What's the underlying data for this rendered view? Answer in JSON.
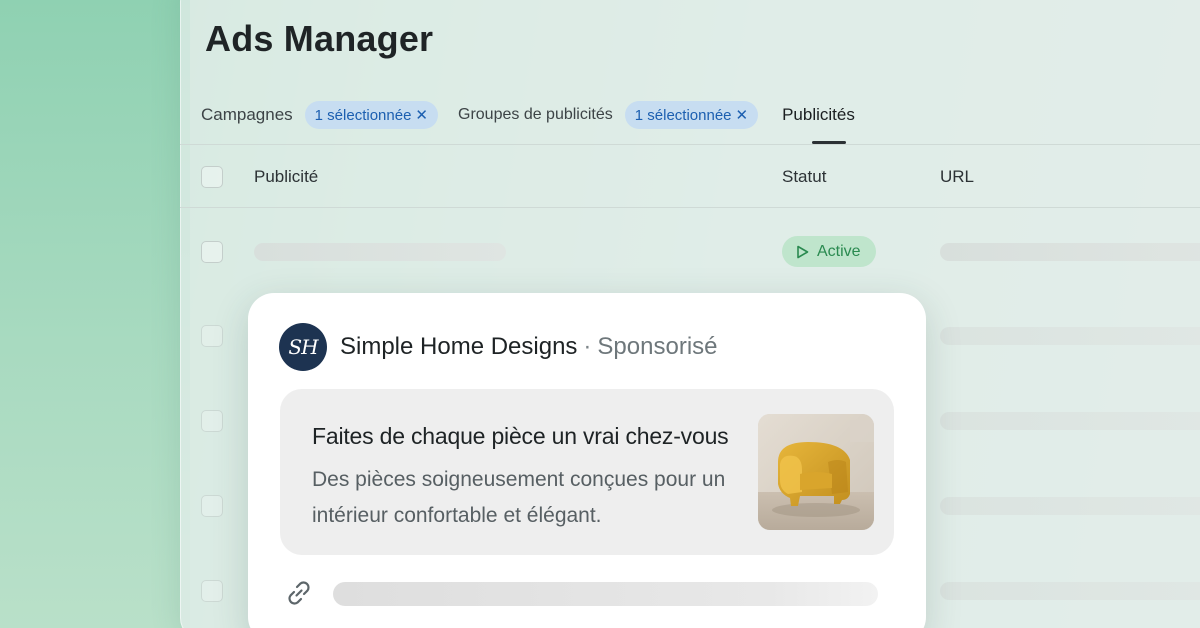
{
  "app": {
    "title": "Ads Manager"
  },
  "tabs": {
    "campaigns_label": "Campagnes",
    "campaigns_chip": "1 sélectionnée",
    "adsets_label": "Groupes de publicités",
    "adsets_chip": "1 sélectionnée",
    "ads_label": "Publicités",
    "chip_close_glyph": "✕"
  },
  "table": {
    "columns": [
      "Publicité",
      "Statut",
      "URL"
    ],
    "rows": [
      {
        "status": "Active",
        "status_icon": "play-icon"
      }
    ]
  },
  "ad_preview": {
    "brand_initials": "SH",
    "brand_name": "Simple Home Designs",
    "separator": "·",
    "sponsored_label": "Sponsorisé",
    "headline": "Faites de chaque pièce un vrai chez-vous",
    "body": "Des pièces soigneusement conçues pour un intérieur confortable et élégant.",
    "image_subject": "yellow armchair",
    "link_icon": "link-icon"
  },
  "colors": {
    "accent_chip_bg": "#c7ddf1",
    "accent_chip_text": "#1c5fb0",
    "status_active_bg": "#bfe5cc",
    "status_active_text": "#2a8a50",
    "brand_avatar": "#1d3351"
  }
}
